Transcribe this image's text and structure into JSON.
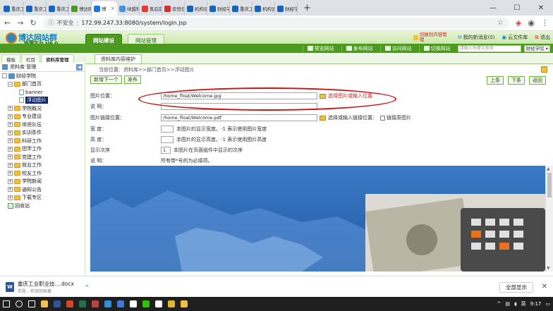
{
  "browser": {
    "tabs": [
      {
        "label": "重庆工",
        "color": "#1565c0",
        "icon": "document-icon"
      },
      {
        "label": "重庆工",
        "color": "#1565c0",
        "icon": "document-icon"
      },
      {
        "label": "重庆工",
        "color": "#1565c0",
        "icon": "document-icon"
      },
      {
        "label": "博达网",
        "color": "#4c9a1f",
        "icon": "leaf-icon"
      },
      {
        "label": "博",
        "color": "#1a73e8",
        "icon": "globe-icon",
        "active": true
      },
      {
        "label": "绿盟科",
        "color": "#4a90e2",
        "icon": "gear-icon"
      },
      {
        "label": "售后前",
        "color": "#e53935",
        "icon": "flag-icon"
      },
      {
        "label": "安恒信",
        "color": "#d32f2f",
        "icon": "shield-icon"
      },
      {
        "label": "机构设",
        "color": "#1565c0",
        "icon": "document-icon"
      },
      {
        "label": "财经学",
        "color": "#1565c0",
        "icon": "document-icon"
      },
      {
        "label": "重庆工",
        "color": "#1565c0",
        "icon": "document-icon"
      },
      {
        "label": "机构设",
        "color": "#1565c0",
        "icon": "document-icon"
      },
      {
        "label": "财经学",
        "color": "#1565c0",
        "icon": "document-icon"
      }
    ],
    "new_tab": "+",
    "window_controls": {
      "minimize": "—",
      "maximize": "☐",
      "close": "✕"
    },
    "insecure_label": "不安全",
    "url": "172.99.247.33:8080/system/login.jsp"
  },
  "header": {
    "logo_title": "博达网站群",
    "logo_subtitle": "管理平台  V6.0",
    "tabs": [
      "网站建设",
      "网站管理"
    ],
    "links": {
      "switch_site": "切换到内容管理",
      "messages": "我的新消息(0)",
      "cloud_library": "云文件库",
      "logout": "退出"
    }
  },
  "menubar": {
    "items": [
      "预览网站",
      "发布网站",
      "访问网站",
      "切换网站"
    ],
    "search_placeholder": "请输入关键字查询",
    "site_select": "财经学院"
  },
  "sidebar": {
    "tabs": [
      "模板",
      "栏目",
      "资料库管理"
    ],
    "header": "资料库 管理",
    "root": "财经学院",
    "tree": [
      {
        "label": "部门首页",
        "level": 1,
        "expanded": true
      },
      {
        "label": "banner",
        "level": 2,
        "doc": true
      },
      {
        "label": "浮动图片",
        "level": 2,
        "doc": true,
        "selected": true
      },
      {
        "label": "学院概况",
        "level": 1
      },
      {
        "label": "专业建设",
        "level": 1
      },
      {
        "label": "师资队伍",
        "level": 1
      },
      {
        "label": "实训条件",
        "level": 1
      },
      {
        "label": "科研工作",
        "level": 1
      },
      {
        "label": "团学工作",
        "level": 1
      },
      {
        "label": "党建工作",
        "level": 1
      },
      {
        "label": "就业工作",
        "level": 1
      },
      {
        "label": "校友工作",
        "level": 1
      },
      {
        "label": "学院新闻",
        "level": 1
      },
      {
        "label": "通知公告",
        "level": 1
      },
      {
        "label": "下载专区",
        "level": 1
      }
    ],
    "recycle": "回收站"
  },
  "main": {
    "tab": "资料库内容维护",
    "breadcrumb": "当前位置：资料库>>部门首页>>浮动图片",
    "buttons": {
      "new_next": "新增下一个",
      "publish": "发布",
      "prev": "上条",
      "next": "下条",
      "back": "返回"
    },
    "form": {
      "image_location_label": "图片位置：",
      "image_location_value": "/home_float/Welcome.jpg",
      "image_location_hint": "选择图片或输入位置",
      "description_label": "说    明：",
      "link_label": "图片链接位置：",
      "link_value": "/home_float/Welcome.pdf",
      "link_hint": "选择或输入链接位置：",
      "link_image_checkbox": "链接原图片",
      "width_label": "宽    度：",
      "width_hint": "本图片的显示宽度。-1 表示使用图片宽度",
      "height_label": "高    度：",
      "height_hint": "本图片的显示高度。-1 表示使用图片高度",
      "order_label": "显示次序",
      "order_value": "1",
      "order_hint": "本图片在页面组件中显示的次序",
      "note_label": "说    明：",
      "note_value": "所有带*号的为必填项。"
    }
  },
  "downloads": {
    "filename": "重庆工业职业技....docx",
    "status": "失败 - 检测到病毒",
    "show_all": "全部显示"
  },
  "taskbar": {
    "time": "9:17",
    "ime": "英",
    "apps": [
      {
        "icon": "windows-icon",
        "color": "#ffffff"
      },
      {
        "icon": "search-icon",
        "color": "#ffffff"
      },
      {
        "icon": "task-view-icon",
        "color": "#ffffff"
      },
      {
        "icon": "explorer-icon",
        "color": "#f2c14e"
      },
      {
        "icon": "word-icon",
        "color": "#2b579a"
      },
      {
        "icon": "powerpoint-icon",
        "color": "#d24726"
      },
      {
        "icon": "excel-icon",
        "color": "#217346"
      },
      {
        "icon": "app-icon",
        "color": "#c43e3e"
      },
      {
        "icon": "edge-icon",
        "color": "#2f8fd8"
      },
      {
        "icon": "app-icon",
        "color": "#3e7bd6"
      },
      {
        "icon": "app-icon",
        "color": "#ffffff"
      },
      {
        "icon": "wechat-icon",
        "color": "#2dc100"
      },
      {
        "icon": "app-icon",
        "color": "#ffffff"
      },
      {
        "icon": "chrome-icon",
        "color": "#e2b72c"
      },
      {
        "icon": "app-icon",
        "color": "#f0c040"
      }
    ]
  }
}
